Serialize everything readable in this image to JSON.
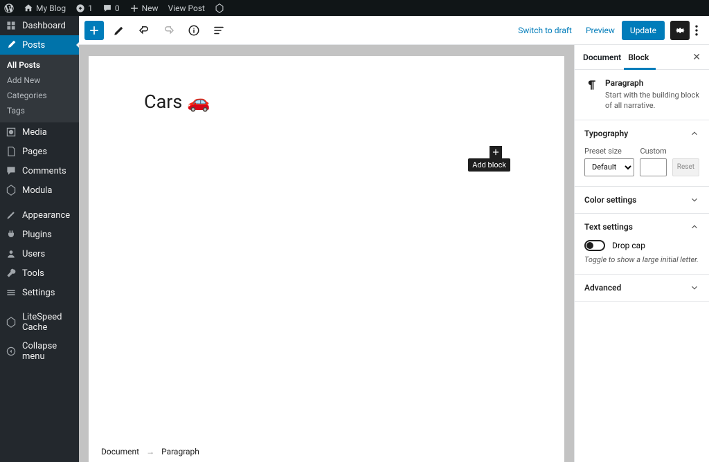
{
  "adminbar": {
    "site_name": "My Blog",
    "updates_count": "1",
    "comments_count": "0",
    "new_label": "New",
    "view_post": "View Post"
  },
  "sidebar": {
    "items": [
      {
        "label": "Dashboard"
      },
      {
        "label": "Posts"
      },
      {
        "label": "Media"
      },
      {
        "label": "Pages"
      },
      {
        "label": "Comments"
      },
      {
        "label": "Modula"
      },
      {
        "label": "Appearance"
      },
      {
        "label": "Plugins"
      },
      {
        "label": "Users"
      },
      {
        "label": "Tools"
      },
      {
        "label": "Settings"
      },
      {
        "label": "LiteSpeed Cache"
      },
      {
        "label": "Collapse menu"
      }
    ],
    "submenu": {
      "all_posts": "All Posts",
      "add_new": "Add New",
      "categories": "Categories",
      "tags": "Tags"
    }
  },
  "toolbar": {
    "switch_to_draft": "Switch to draft",
    "preview": "Preview",
    "update": "Update"
  },
  "editor": {
    "title": "Cars 🚗",
    "tooltip_add_block": "Add block"
  },
  "breadcrumb": {
    "root": "Document",
    "current": "Paragraph"
  },
  "settings": {
    "tabs": {
      "document": "Document",
      "block": "Block"
    },
    "block_info": {
      "name": "Paragraph",
      "desc": "Start with the building block of all narrative."
    },
    "typography": {
      "title": "Typography",
      "preset_label": "Preset size",
      "preset_value": "Default",
      "custom_label": "Custom",
      "reset": "Reset"
    },
    "color": {
      "title": "Color settings"
    },
    "text": {
      "title": "Text settings",
      "dropcap": "Drop cap",
      "help": "Toggle to show a large initial letter."
    },
    "advanced": {
      "title": "Advanced"
    }
  }
}
